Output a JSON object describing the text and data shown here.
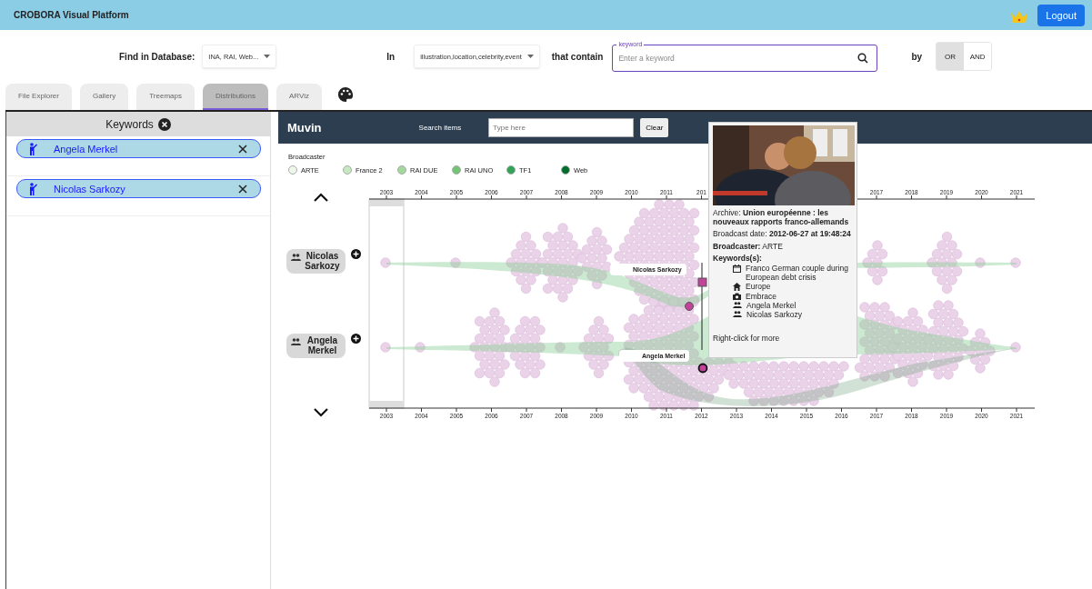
{
  "app": {
    "title": "CROBORA Visual Platform",
    "logout": "Logout"
  },
  "search": {
    "database_label": "Find in Database:",
    "database_value": "INA, RAI, Web...",
    "in_label": "In",
    "fields_value": "illustration,location,celebrity,event",
    "contain_label": "that contain",
    "keyword_label": "keyword",
    "keyword_placeholder": "Enter a keyword",
    "by_label": "by",
    "modes": [
      {
        "label": "OR",
        "selected": true
      },
      {
        "label": "AND",
        "selected": false
      }
    ]
  },
  "tabs": [
    {
      "label": "File Explorer",
      "selected": false
    },
    {
      "label": "Gallery",
      "selected": false
    },
    {
      "label": "Treemaps",
      "selected": false
    },
    {
      "label": "Distributions",
      "selected": true
    },
    {
      "label": "ARViz",
      "selected": false
    }
  ],
  "keywords_panel": {
    "title": "Keywords",
    "items": [
      {
        "label": "Angela Merkel"
      },
      {
        "label": "Nicolas Sarkozy"
      }
    ]
  },
  "muvin": {
    "title": "Muvin",
    "search_label": "Search items",
    "search_placeholder": "Type here",
    "clear": "Clear",
    "legend_title": "Broadcaster",
    "broadcasters": [
      {
        "label": "ARTE",
        "color": "#edf8e9"
      },
      {
        "label": "France 2",
        "color": "#c7e9c0"
      },
      {
        "label": "RAI DUE",
        "color": "#a1d99b"
      },
      {
        "label": "RAI UNO",
        "color": "#74c476"
      },
      {
        "label": "TF1",
        "color": "#31a354"
      },
      {
        "label": "Web",
        "color": "#006d2c"
      }
    ],
    "rows": [
      {
        "label": "Nicolas Sarkozy"
      },
      {
        "label": "Angela Merkel"
      }
    ],
    "stream_labels": [
      "Nicolas Sarkozy",
      "Angela Merkel"
    ],
    "top_axis_years": [
      "2003",
      "2004",
      "2005",
      "2006",
      "2007",
      "2008",
      "2009",
      "2010",
      "2011",
      "201",
      "2017",
      "2018",
      "2019",
      "2020",
      "2021"
    ],
    "bottom_axis_years": [
      "2003",
      "2004",
      "2005",
      "2006",
      "2007",
      "2008",
      "2009",
      "2010",
      "2011",
      "2012",
      "2013",
      "2014",
      "2015",
      "2016",
      "2017",
      "2018",
      "2019",
      "2020",
      "2021"
    ]
  },
  "tooltip": {
    "archive_label": "Archive:",
    "archive_title": "Union européenne : les nouveaux rapports franco-allemands",
    "date_label": "Broadcast date:",
    "date_value": "2012-06-27 at 19:48:24",
    "broadcaster_label": "Broadcaster:",
    "broadcaster_value": "ARTE",
    "keywords_label": "Keywords(s):",
    "keywords": [
      {
        "kind": "illustration",
        "label": "Franco German couple during European debt crisis"
      },
      {
        "kind": "location",
        "label": "Europe"
      },
      {
        "kind": "event",
        "label": "Embrace"
      },
      {
        "kind": "celebrity",
        "label": "Angela Merkel"
      },
      {
        "kind": "celebrity",
        "label": "Nicolas Sarkozy"
      }
    ],
    "hint": "Right-click for more"
  }
}
